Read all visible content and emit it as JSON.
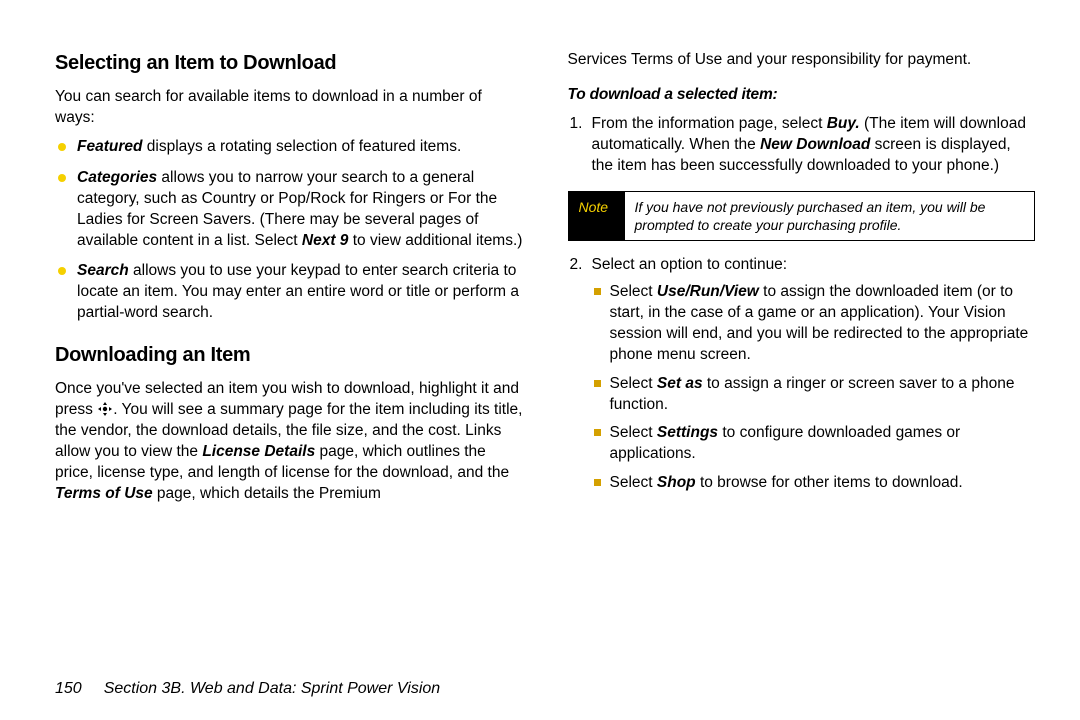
{
  "left": {
    "h1": "Selecting an Item to Download",
    "intro": "You can search for available items to download in a number of ways:",
    "bullets": {
      "b1_bold": "Featured",
      "b1_rest": " displays a rotating selection of featured items.",
      "b2_bold": "Categories",
      "b2_rest": " allows you to narrow your search to a general category, such as Country or Pop/Rock for Ringers or For the Ladies for Screen Savers. (There may be several pages of available content in a list. Select ",
      "b2_bold2": "Next 9",
      "b2_rest2": " to view additional items.)",
      "b3_bold": "Search",
      "b3_rest": " allows you to use your keypad to enter search criteria to locate an item. You may enter an entire word or title or perform a partial-word search."
    },
    "h2": "Downloading an Item",
    "dl_p1a": "Once you've selected an item you wish to download, highlight it and press ",
    "dl_p1b": ". You will see a summary page for the item including its title, the vendor, the download details, the file size, and the cost. Links allow you to view the ",
    "dl_bold1": "License Details",
    "dl_p1c": " page, which outlines the price, license type, and length of license for the download, and the ",
    "dl_bold2": "Terms of Use",
    "dl_p1d": " page, which details the Premium"
  },
  "right": {
    "cont": "Services Terms of Use and your responsibility for payment.",
    "subhead": "To download a selected item:",
    "step1a": "From the information page, select ",
    "step1_bold1": "Buy.",
    "step1b": " (The item will download automatically. When the ",
    "step1_bold2": "New Download",
    "step1c": " screen is displayed, the item has been successfully downloaded to your phone.)",
    "note_label": "Note",
    "note_text": "If you have not previously purchased an item, you will be prompted to create your purchasing profile.",
    "step2_lead": "Select an option to continue:",
    "sq1a": "Select ",
    "sq1_bold": "Use/Run/View",
    "sq1b": " to assign the downloaded item (or to start, in the case of a game or an application). Your Vision session will end, and you will be redirected to the appropriate phone menu screen.",
    "sq2a": "Select ",
    "sq2_bold": "Set as",
    "sq2b": " to assign a ringer or screen saver to a phone function.",
    "sq3a": "Select ",
    "sq3_bold": "Settings",
    "sq3b": " to configure downloaded games or applications.",
    "sq4a": "Select ",
    "sq4_bold": "Shop",
    "sq4b": " to browse for other items to download."
  },
  "footer": {
    "page": "150",
    "section": "Section 3B. Web and Data: Sprint Power Vision"
  }
}
